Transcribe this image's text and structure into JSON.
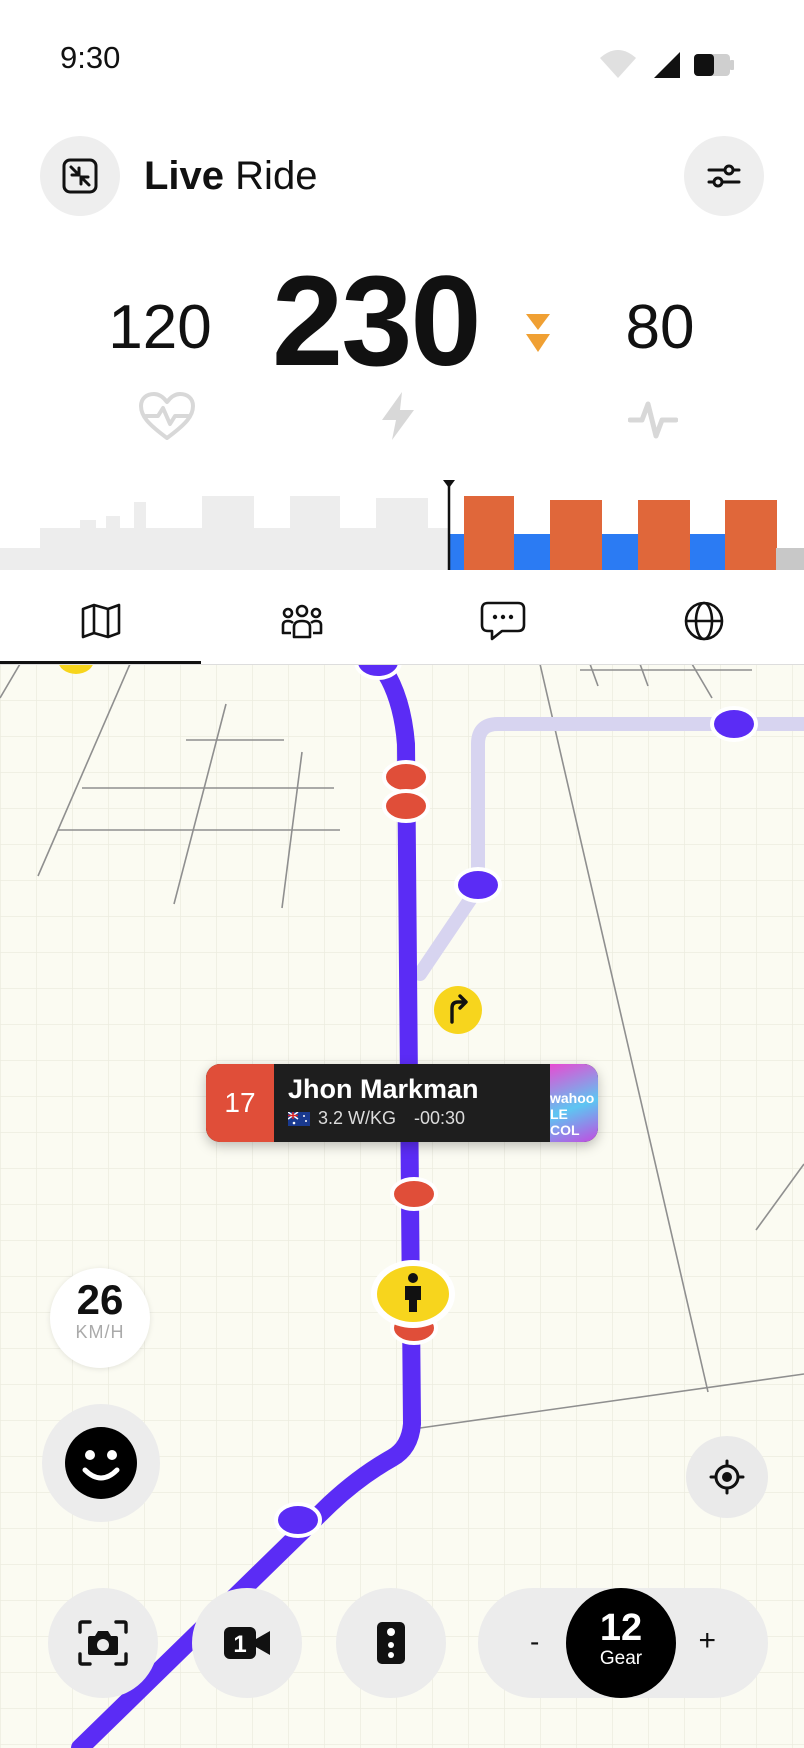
{
  "status_bar": {
    "time": "9:30"
  },
  "header": {
    "title_bold": "Live",
    "title_regular": "Ride"
  },
  "metrics": {
    "heart_rate": "120",
    "power": "230",
    "cadence": "80"
  },
  "tabs": [
    {
      "name": "map",
      "icon": "map-icon",
      "active": true
    },
    {
      "name": "riders",
      "icon": "group-icon",
      "active": false
    },
    {
      "name": "chat",
      "icon": "chat-icon",
      "active": false
    },
    {
      "name": "world",
      "icon": "globe-icon",
      "active": false
    }
  ],
  "rider_card": {
    "position": "17",
    "name": "Jhon Markman",
    "wkg": "3.2 W/KG",
    "gap": "-00:30",
    "jersey_text": "wahoo LE COL"
  },
  "speed": {
    "value": "26",
    "unit": "KM/H"
  },
  "gear": {
    "value": "12",
    "label": "Gear",
    "minus": "-",
    "plus": "+"
  },
  "video_button_label": "1",
  "colors": {
    "route": "#5b2cf5",
    "rider_red": "#e04e39",
    "marker_yellow": "#f7d51d",
    "interval_orange": "#e0673a",
    "interval_blue": "#2b7bf3",
    "trend_orange": "#f0a033"
  }
}
